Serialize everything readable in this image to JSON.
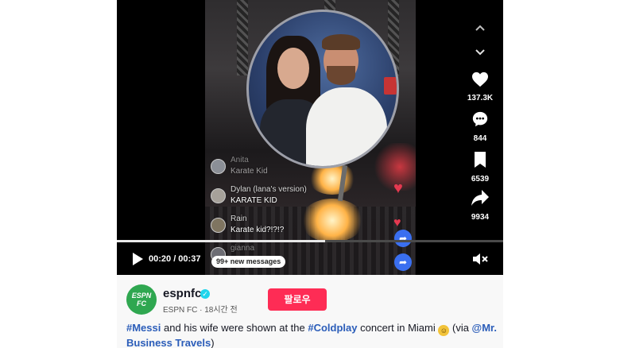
{
  "player": {
    "comments": [
      {
        "user": "Anita",
        "text": "Karate Kid",
        "faded": true
      },
      {
        "user": "Dylan (lana's version)",
        "text": "KARATE KID",
        "faded": false
      },
      {
        "user": "Rain",
        "text": "Karate kid?!?!?",
        "faded": false
      },
      {
        "user": "gianna",
        "text": "",
        "faded": true
      }
    ],
    "new_messages_label": "99+ new messages",
    "time_display": "00:20 / 00:37",
    "progress": 0.54
  },
  "actions": {
    "likes": "137.3K",
    "comments": "844",
    "saves": "6539",
    "shares": "9934"
  },
  "info": {
    "logo_text": "ESPN FC",
    "account_name": "espnfc",
    "account_sub": "ESPN FC · 18시간 전",
    "follow_label": "팔로우",
    "caption": {
      "tag1": "#Messi",
      "text1": " and his wife were shown at the ",
      "tag2": "#Coldplay",
      "text2": " concert in Miami ",
      "text3": " (via ",
      "mention": "@Mr. Business Travels",
      "text4": ")"
    }
  },
  "colors": {
    "follow_button": "#fe2c55",
    "hashtag": "#2b5db9",
    "verified": "#20d5ec",
    "logo": "#2fa750"
  },
  "icons": {
    "nav_up": "chevron-up-icon",
    "nav_down": "chevron-down-icon",
    "like": "heart-icon",
    "comment": "comment-bubble-icon",
    "save": "bookmark-icon",
    "share": "share-arrow-icon",
    "play": "play-icon",
    "mute": "muted-speaker-icon"
  }
}
